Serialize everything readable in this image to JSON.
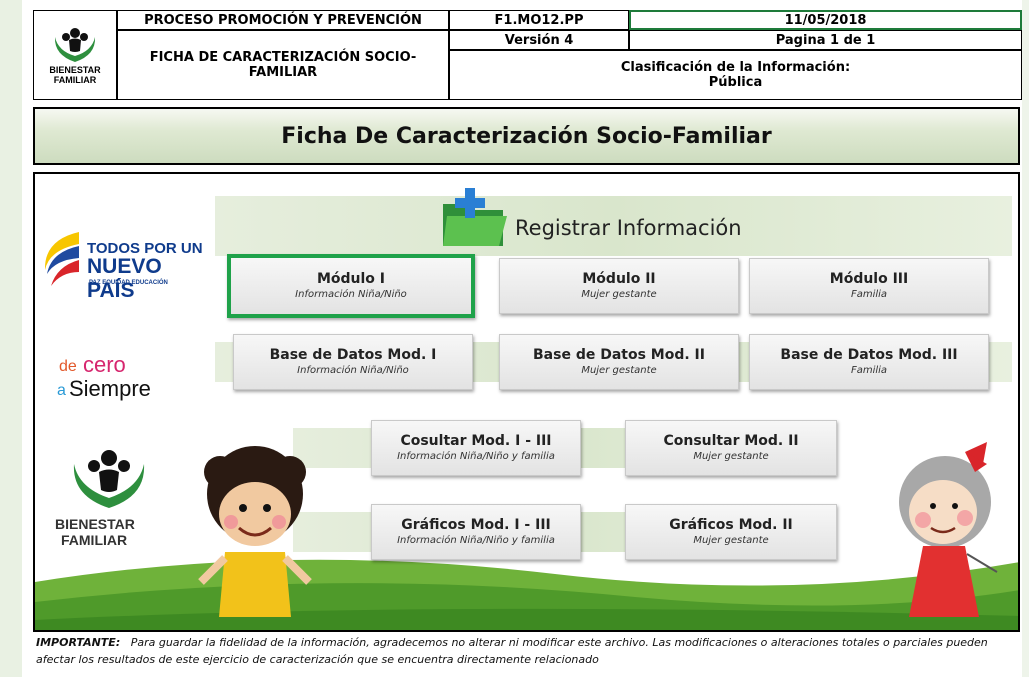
{
  "header": {
    "logo_text_line1": "BIENESTAR",
    "logo_text_line2": "FAMILIAR",
    "process": "PROCESO PROMOCIÓN Y PREVENCIÓN",
    "form_title": "FICHA DE CARACTERIZACIÓN SOCIO-FAMILIAR",
    "code": "F1.MO12.PP",
    "date": "11/05/2018",
    "version": "Versión 4",
    "page": "Pagina 1 de 1",
    "classification_label": "Clasificación de la Información:",
    "classification_value": "Pública"
  },
  "title": "Ficha De Caracterización Socio-Familiar",
  "register": {
    "label": "Registrar Información"
  },
  "logos": {
    "todos_line1": "TODOS POR UN",
    "todos_line2": "NUEVO PAÍS",
    "todos_line3": "PAZ  EQUIDAD  EDUCACIÓN",
    "cero_de": "de",
    "cero_cero": "cero",
    "cero_a": "a",
    "cero_siempre": "Siempre",
    "bf_line1": "BIENESTAR",
    "bf_line2": "FAMILIAR"
  },
  "buttons": {
    "mod1": {
      "title": "Módulo I",
      "subtitle": "Información Niña/Niño"
    },
    "mod2": {
      "title": "Módulo II",
      "subtitle": "Mujer gestante"
    },
    "mod3": {
      "title": "Módulo III",
      "subtitle": "Familia"
    },
    "db1": {
      "title": "Base de Datos Mod. I",
      "subtitle": "Información Niña/Niño"
    },
    "db2": {
      "title": "Base de Datos Mod. II",
      "subtitle": "Mujer gestante"
    },
    "db3": {
      "title": "Base de Datos Mod. III",
      "subtitle": "Familia"
    },
    "q13": {
      "title": "Cosultar Mod. I - III",
      "subtitle": "Información Niña/Niño y familia"
    },
    "q2": {
      "title": "Consultar Mod. II",
      "subtitle": "Mujer gestante"
    },
    "g13": {
      "title": "Gráficos Mod. I - III",
      "subtitle": "Información Niña/Niño y familia"
    },
    "g2": {
      "title": "Gráficos Mod. II",
      "subtitle": "Mujer gestante"
    }
  },
  "footer": {
    "label": "IMPORTANTE:",
    "text": "Para guardar la fidelidad de la información, agradecemos no alterar ni modificar este archivo. Las modificaciones o alteraciones totales o parciales pueden afectar los resultados de este ejercicio de caracterización que se encuentra directamente relacionado"
  }
}
